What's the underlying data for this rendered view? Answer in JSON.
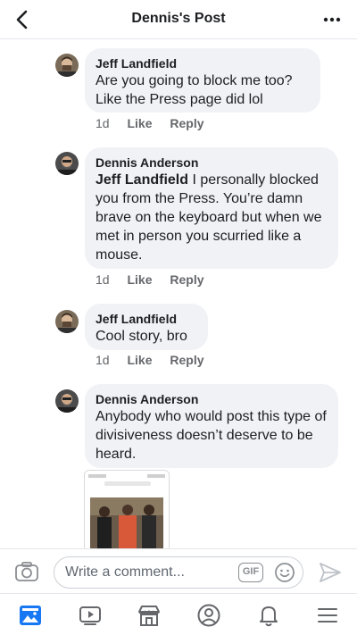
{
  "header": {
    "title": "Dennis's Post"
  },
  "comments": [
    {
      "author": "Jeff Landfield",
      "text": "Are you going to block me too? Like the Press page did lol",
      "time": "1d",
      "like": "Like",
      "reply": "Reply"
    },
    {
      "author": "Dennis Anderson",
      "mention": "Jeff Landfield",
      "text": " I personally blocked you from the Press. You’re damn brave on the keyboard but when we met in person you scurried like a mouse.",
      "time": "1d",
      "like": "Like",
      "reply": "Reply"
    },
    {
      "author": "Jeff Landfield",
      "text": "Cool story, bro",
      "time": "1d",
      "like": "Like",
      "reply": "Reply"
    },
    {
      "author": "Dennis Anderson",
      "text": "Anybody who would post this type of divisiveness doesn’t deserve to be heard."
    }
  ],
  "composer": {
    "placeholder": "Write a comment...",
    "gif_label": "GIF"
  },
  "icons": {
    "back": "back-arrow-icon",
    "more": "more-dots-icon",
    "camera": "camera-icon",
    "emoji": "emoji-icon",
    "send": "send-icon",
    "nav": [
      "news-feed-icon",
      "watch-icon",
      "marketplace-icon",
      "profile-icon",
      "notifications-icon",
      "menu-icon"
    ]
  },
  "colors": {
    "accent": "#1877f2",
    "bubble": "#f0f2f5",
    "muted": "#65676b"
  }
}
